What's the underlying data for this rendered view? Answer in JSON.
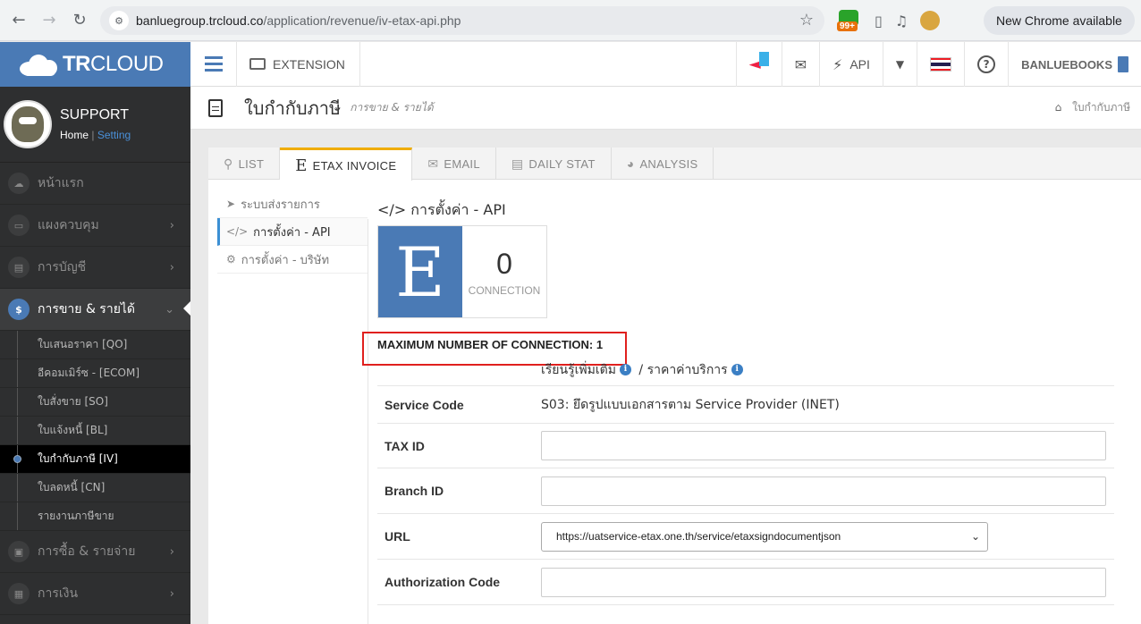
{
  "browser": {
    "url_host": "banluegroup.trcloud.co",
    "url_path": "/application/revenue/iv-etax-api.php",
    "ext_badge": "99+",
    "update_label": "New Chrome available"
  },
  "sidebar": {
    "logo_bold": "TR",
    "logo_thin": "CLOUD",
    "profile_name": "SUPPORT",
    "home_link": "Home",
    "setting_link": "Setting",
    "menu": [
      {
        "label": "หน้าแรก"
      },
      {
        "label": "แผงควบคุม"
      },
      {
        "label": "การบัญชี"
      },
      {
        "label": "การขาย & รายได้"
      }
    ],
    "sub_items": [
      {
        "label": "ใบเสนอราคา [QO]"
      },
      {
        "label": "อีคอมเมิร์ซ - [ECOM]"
      },
      {
        "label": "ใบสั่งขาย [SO]"
      },
      {
        "label": "ใบแจ้งหนี้ [BL]"
      },
      {
        "label": "ใบกำกับภาษี [IV]"
      },
      {
        "label": "ใบลดหนี้ [CN]"
      },
      {
        "label": "รายงานภาษีขาย"
      }
    ],
    "menu_bottom": [
      {
        "label": "การซื้อ & รายจ่าย"
      },
      {
        "label": "การเงิน"
      }
    ],
    "icon_currency": "$"
  },
  "topbar": {
    "extension_label": "EXTENSION",
    "api_label": "API",
    "user_label": "BANLUEBOOKS",
    "flag_colors": [
      "#ed1c24",
      "#ffffff",
      "#241d4f",
      "#ffffff",
      "#ed1c24"
    ]
  },
  "header": {
    "title": "ใบกำกับภาษี",
    "subtitle": "การขาย & รายได้",
    "breadcrumb": "ใบกำกับภาษี"
  },
  "tabs": [
    {
      "icon": "search-icon",
      "label": "LIST"
    },
    {
      "icon": "e-icon",
      "label": "ETAX INVOICE",
      "glyph": "E"
    },
    {
      "icon": "envelope-icon",
      "label": "EMAIL"
    },
    {
      "icon": "bar-chart-icon",
      "label": "DAILY STAT"
    },
    {
      "icon": "pie-chart-icon",
      "label": "ANALYSIS"
    }
  ],
  "side_nav": [
    {
      "label": "ระบบส่งรายการ"
    },
    {
      "label": "การตั้งค่า - API"
    },
    {
      "label": "การตั้งค่า - บริษัท"
    }
  ],
  "content": {
    "section_title": "การตั้งค่า - API",
    "counter_letter": "E",
    "connection_count": "0",
    "connection_label": "CONNECTION",
    "max_connection": "MAXIMUM NUMBER OF CONNECTION: 1",
    "learn_more": "เรียนรู้เพิ่มเติม",
    "separator": "/",
    "pricing": "ราคาค่าบริการ",
    "info_glyph": "i",
    "service_code_label": "Service Code",
    "service_code_value": "S03: ยึดรูปแบบเอกสารตาม Service Provider (INET)",
    "tax_id_label": "TAX ID",
    "tax_id_value": "",
    "branch_id_label": "Branch ID",
    "branch_id_value": "",
    "url_label": "URL",
    "url_value": "https://uatservice-etax.one.th/service/etaxsigndocumentjson",
    "auth_label": "Authorization Code",
    "auth_value": ""
  },
  "colors": {
    "brand_blue": "#4a7ab5",
    "highlight_red": "#e0201e",
    "active_tab_accent": "#f0ad00"
  }
}
